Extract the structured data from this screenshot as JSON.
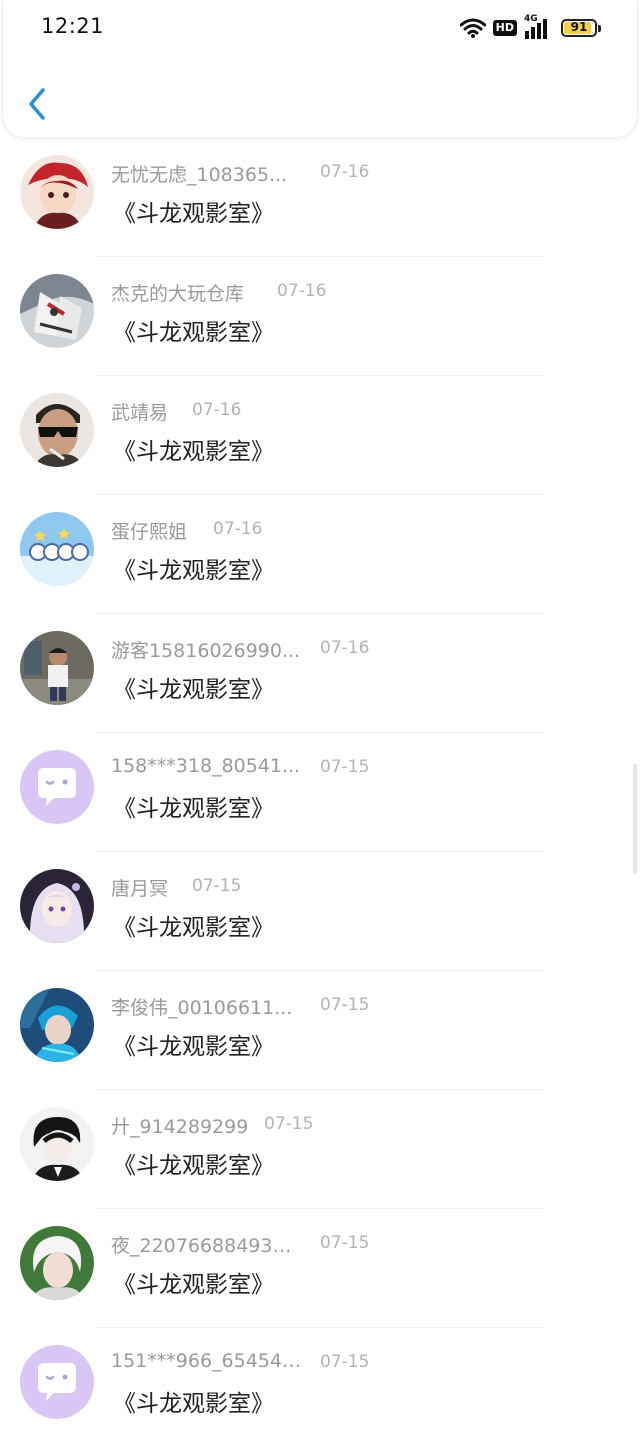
{
  "status_bar": {
    "time": "12:21",
    "network": "4G",
    "hd": "HD",
    "battery": "91",
    "battery_level": 0.91
  },
  "nav": {
    "back_icon": "chevron-left-icon"
  },
  "items": [
    {
      "name": "无忧无虑_108365...",
      "date": "07-16",
      "message": "《斗龙观影室》",
      "avatar": "anime-boy-red-hair"
    },
    {
      "name": "杰克的大玩仓库",
      "date": "07-16",
      "message": "《斗龙观影室》",
      "avatar": "robot-figure"
    },
    {
      "name": "武靖易",
      "date": "07-16",
      "message": "《斗龙观影室》",
      "avatar": "man-sunglasses"
    },
    {
      "name": "蛋仔熙姐",
      "date": "07-16",
      "message": "《斗龙观影室》",
      "avatar": "cartoon-characters-sky"
    },
    {
      "name": "游客15816026990...",
      "date": "07-16",
      "message": "《斗龙观影室》",
      "avatar": "child-photo"
    },
    {
      "name": "158***318_80541...",
      "date": "07-15",
      "message": "《斗龙观影室》",
      "avatar": "default-chat-bubble"
    },
    {
      "name": "唐月冥",
      "date": "07-15",
      "message": "《斗龙观影室》",
      "avatar": "anime-girl-white-hair"
    },
    {
      "name": "李俊伟_00106611...",
      "date": "07-15",
      "message": "《斗龙观影室》",
      "avatar": "game-character-blue"
    },
    {
      "name": "廾_914289299",
      "date": "07-15",
      "message": "《斗龙观影室》",
      "avatar": "anime-man-dark-hair"
    },
    {
      "name": "夜_220766884938...",
      "date": "07-15",
      "message": "《斗龙观影室》",
      "avatar": "white-hair-portrait"
    },
    {
      "name": "151***966_654546...",
      "date": "07-15",
      "message": "《斗龙观影室》",
      "avatar": "default-chat-bubble"
    }
  ],
  "colors": {
    "name": "#9a9a9a",
    "date": "#b3b3b3",
    "message": "#222222",
    "accent": "#2a8fdb",
    "default_avatar": "#d8c6f5"
  }
}
